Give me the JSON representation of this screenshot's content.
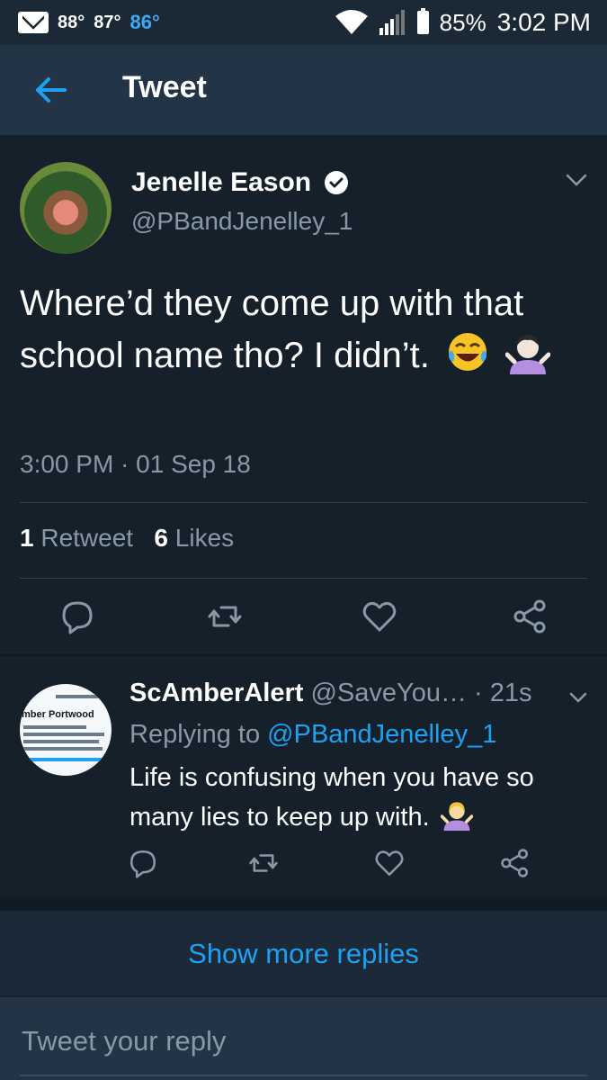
{
  "status_bar": {
    "temps": [
      "88°",
      "87°",
      "86°"
    ],
    "battery": "85%",
    "time": "3:02 PM"
  },
  "header": {
    "title": "Tweet"
  },
  "tweet": {
    "author_name": "Jenelle Eason",
    "author_handle": "@PBandJenelley_1",
    "text": "Where’d they come up with that school name tho? I didn’t.",
    "emojis": [
      "face-with-tears-of-joy-icon",
      "person-shrugging-icon"
    ],
    "timestamp": "3:00 PM · 01 Sep 18",
    "retweets_count": "1",
    "retweets_label": "Retweet",
    "likes_count": "6",
    "likes_label": "Likes"
  },
  "reply": {
    "author_name": "ScAmberAlert",
    "author_handle": "@SaveYou…",
    "age": "· 21s",
    "replying_prefix": "Replying to",
    "replying_to": "@PBandJenelley_1",
    "text": "Life is confusing when you have so many lies to keep up with.",
    "avatar_text": "mber Portwood"
  },
  "show_more": "Show more replies",
  "compose": {
    "placeholder": "Tweet your reply"
  },
  "colors": {
    "background": "#15202b",
    "app_bar": "#243447",
    "accent": "#1da1f2",
    "muted": "#8899a6"
  }
}
